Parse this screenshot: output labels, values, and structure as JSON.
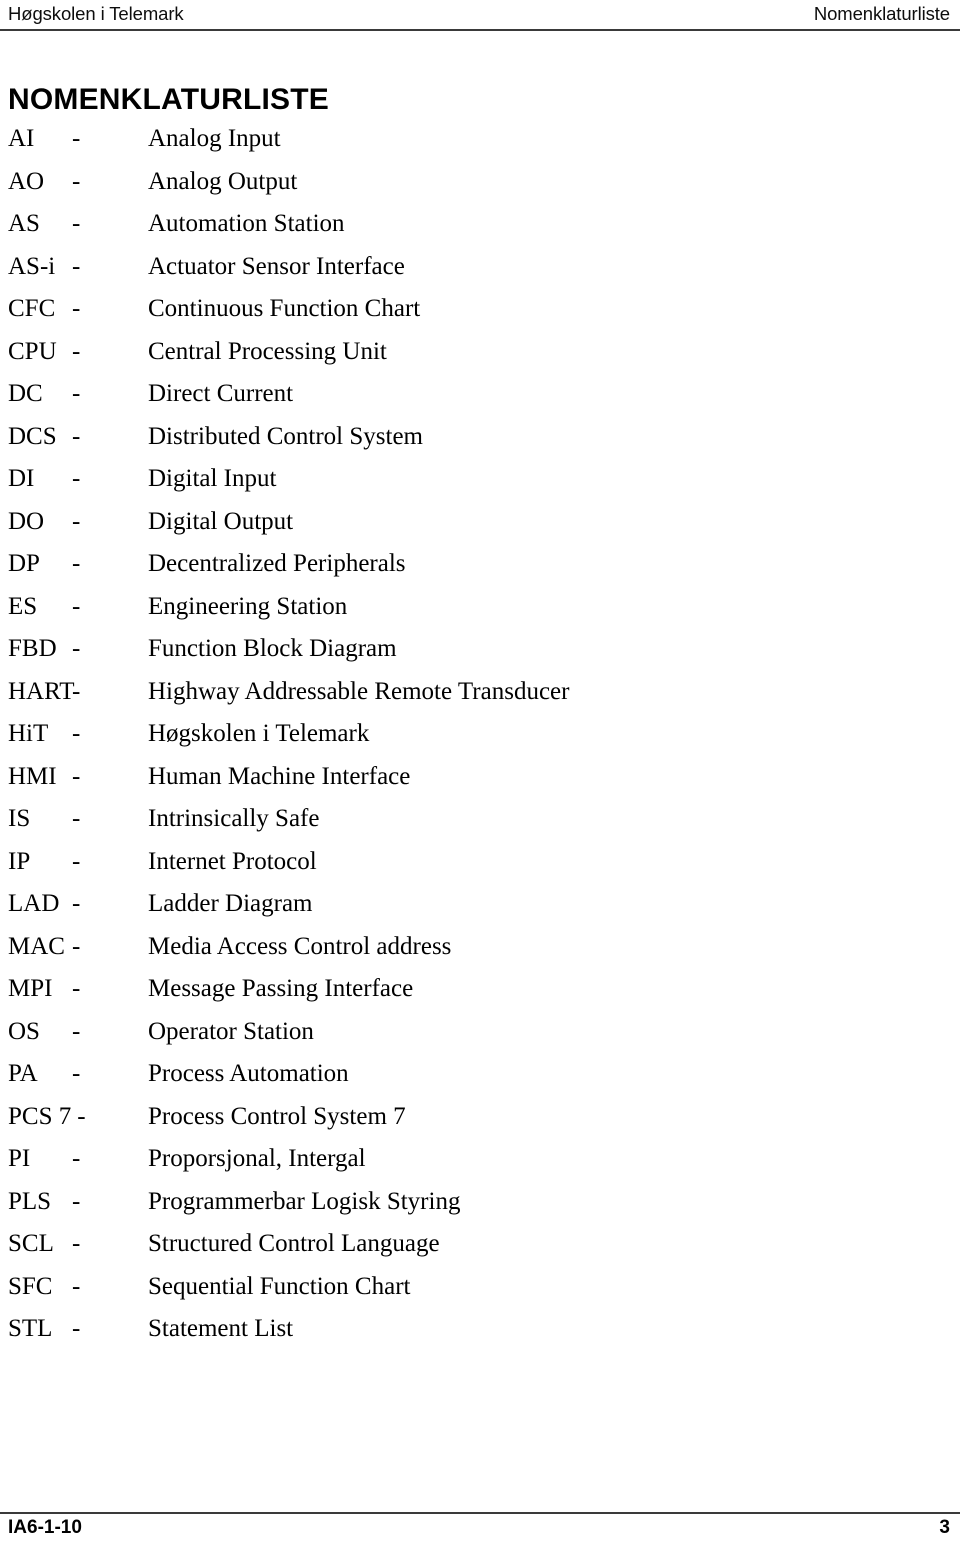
{
  "header": {
    "left": "Høgskolen i Telemark",
    "right": "Nomenklaturliste"
  },
  "title": "NOMENKLATURLISTE",
  "separator": "-",
  "entries": [
    {
      "abbr": "AI",
      "sep": "-",
      "definition": "Analog Input"
    },
    {
      "abbr": "AO",
      "sep": "-",
      "definition": "Analog Output"
    },
    {
      "abbr": "AS",
      "sep": "-",
      "definition": "Automation Station"
    },
    {
      "abbr": "AS-i",
      "sep": "-",
      "definition": "Actuator Sensor Interface"
    },
    {
      "abbr": "CFC",
      "sep": "-",
      "definition": "Continuous Function Chart"
    },
    {
      "abbr": "CPU",
      "sep": "-",
      "definition": "Central Processing Unit"
    },
    {
      "abbr": "DC",
      "sep": "-",
      "definition": "Direct Current"
    },
    {
      "abbr": "DCS",
      "sep": "-",
      "definition": "Distributed Control System"
    },
    {
      "abbr": "DI",
      "sep": "-",
      "definition": "Digital Input"
    },
    {
      "abbr": "DO",
      "sep": "-",
      "definition": "Digital Output"
    },
    {
      "abbr": "DP",
      "sep": "-",
      "definition": "Decentralized Peripherals"
    },
    {
      "abbr": "ES",
      "sep": "-",
      "definition": "Engineering Station"
    },
    {
      "abbr": "FBD",
      "sep": "-",
      "definition": "Function Block Diagram"
    },
    {
      "abbr": "HART",
      "sep": "-",
      "definition": "Highway Addressable Remote Transducer"
    },
    {
      "abbr": "HiT",
      "sep": "-",
      "definition": "Høgskolen i Telemark"
    },
    {
      "abbr": "HMI",
      "sep": "-",
      "definition": "Human Machine Interface"
    },
    {
      "abbr": "IS",
      "sep": "-",
      "definition": "Intrinsically Safe"
    },
    {
      "abbr": "IP",
      "sep": "-",
      "definition": "Internet Protocol"
    },
    {
      "abbr": "LAD",
      "sep": "-",
      "definition": "Ladder Diagram"
    },
    {
      "abbr": "MAC",
      "sep": "-",
      "definition": "Media Access Control address"
    },
    {
      "abbr": "MPI",
      "sep": "-",
      "definition": "Message Passing Interface"
    },
    {
      "abbr": "OS",
      "sep": "-",
      "definition": "Operator Station"
    },
    {
      "abbr": "PA",
      "sep": "-",
      "definition": "Process Automation"
    },
    {
      "abbr": "PCS 7",
      "sep": "-",
      "definition": "Process Control System 7"
    },
    {
      "abbr": "PI",
      "sep": "-",
      "definition": "Proporsjonal, Intergal"
    },
    {
      "abbr": "PLS",
      "sep": "-",
      "definition": "Programmerbar Logisk Styring"
    },
    {
      "abbr": "SCL",
      "sep": "-",
      "definition": "Structured Control Language"
    },
    {
      "abbr": "SFC",
      "sep": "-",
      "definition": "Sequential Function Chart"
    },
    {
      "abbr": "STL",
      "sep": "-",
      "definition": "Statement List"
    }
  ],
  "footer": {
    "document_code": "IA6-1-10",
    "page_number": "3"
  },
  "colors": {
    "text": "#000000",
    "rule": "#3a3a3a",
    "background": "#ffffff"
  }
}
